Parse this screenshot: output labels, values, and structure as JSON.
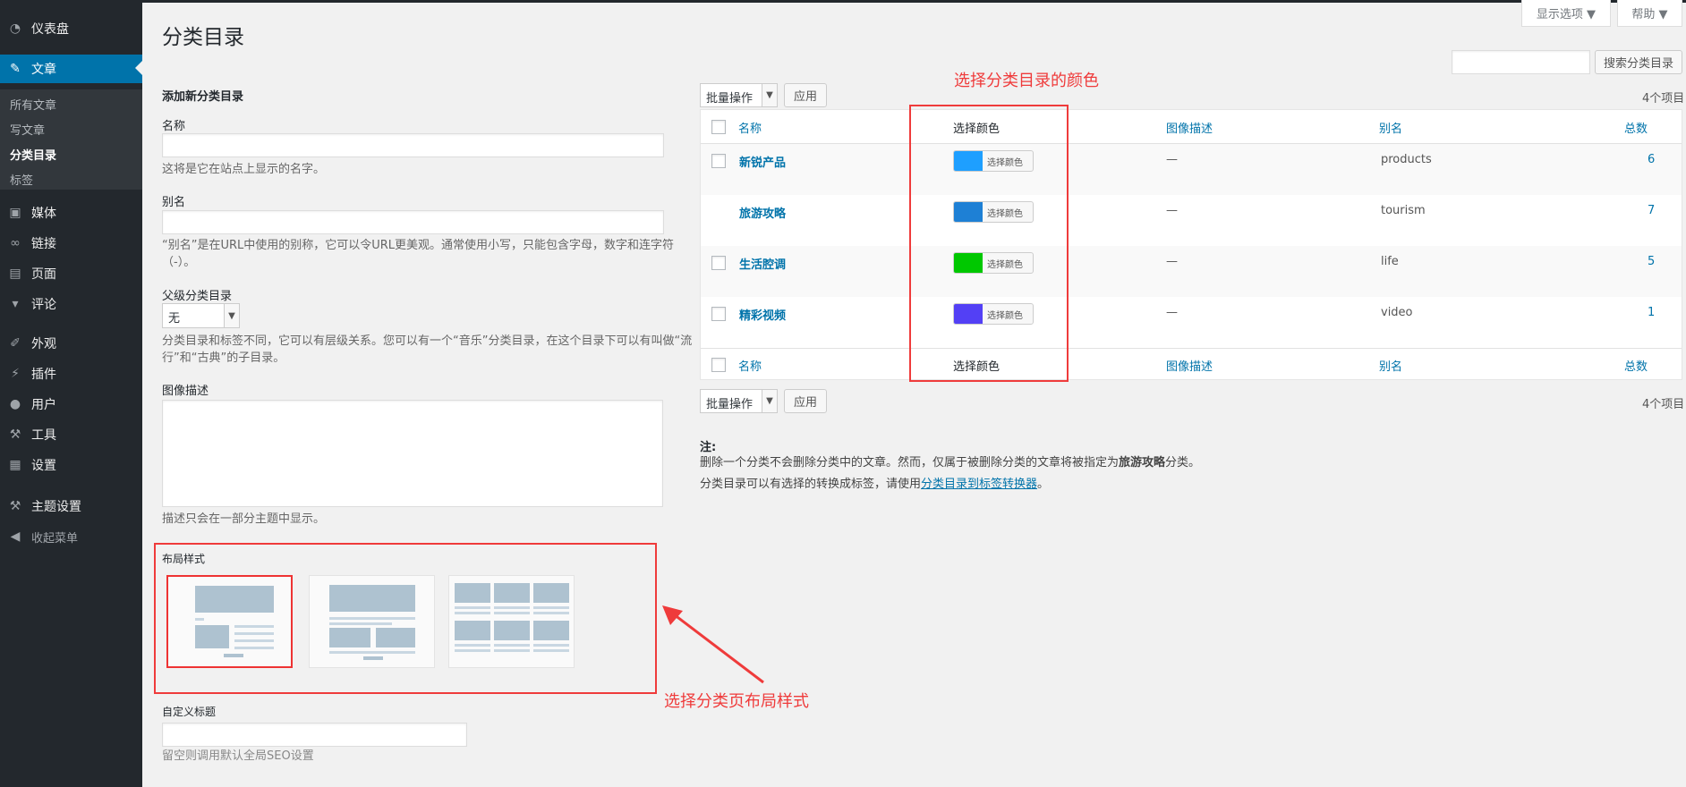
{
  "sidebar": {
    "items": [
      {
        "label": "仪表盘",
        "icon": "dashboard-icon"
      },
      {
        "label": "文章",
        "icon": "pin-icon"
      },
      {
        "label": "媒体",
        "icon": "media-icon"
      },
      {
        "label": "链接",
        "icon": "link-icon"
      },
      {
        "label": "页面",
        "icon": "page-icon"
      },
      {
        "label": "评论",
        "icon": "comment-icon"
      },
      {
        "label": "外观",
        "icon": "brush-icon"
      },
      {
        "label": "插件",
        "icon": "plugin-icon"
      },
      {
        "label": "用户",
        "icon": "user-icon"
      },
      {
        "label": "工具",
        "icon": "wrench-icon"
      },
      {
        "label": "设置",
        "icon": "settings-icon"
      },
      {
        "label": "主题设置",
        "icon": "hammer-icon"
      },
      {
        "label": "收起菜单",
        "icon": "collapse-icon"
      }
    ],
    "sub": [
      "所有文章",
      "写文章",
      "分类目录",
      "标签"
    ]
  },
  "topbar": {
    "screen_options": "显示选项 ▼",
    "help": "帮助 ▼"
  },
  "page_title": "分类目录",
  "form": {
    "heading": "添加新分类目录",
    "name_label": "名称",
    "name_help": "这将是它在站点上显示的名字。",
    "slug_label": "别名",
    "slug_help_1": "“别名”是在URL中使用的别称，它可以令URL更美观。通常使用小写，只能包含字母，数字和连字符",
    "slug_help_2": "（-）。",
    "parent_label": "父级分类目录",
    "parent_value": "无",
    "parent_help_1": "分类目录和标签不同，它可以有层级关系。您可以有一个“音乐”分类目录，在这个目录下可以有叫做“流",
    "parent_help_2": "行”和“古典”的子目录。",
    "desc_label": "图像描述",
    "desc_help": "描述只会在一部分主题中显示。",
    "layout_label": "布局样式",
    "custom_title_label": "自定义标题",
    "custom_title_help": "留空则调用默认全局SEO设置"
  },
  "search": {
    "button": "搜索分类目录"
  },
  "bulk": {
    "select": "批量操作",
    "apply": "应用",
    "count": "4个项目"
  },
  "table": {
    "headers": {
      "name": "名称",
      "color": "选择颜色",
      "desc": "图像描述",
      "slug": "别名",
      "count": "总数"
    },
    "rows": [
      {
        "name": "新锐产品",
        "color": "#1e9fff",
        "color_btn": "选择颜色",
        "desc": "—",
        "slug": "products",
        "count": "6"
      },
      {
        "name": "旅游攻略",
        "color": "#1e80d5",
        "color_btn": "选择颜色",
        "desc": "—",
        "slug": "tourism",
        "count": "7"
      },
      {
        "name": "生活腔调",
        "color": "#00c800",
        "color_btn": "选择颜色",
        "desc": "—",
        "slug": "life",
        "count": "5"
      },
      {
        "name": "精彩视频",
        "color": "#5340f5",
        "color_btn": "选择颜色",
        "desc": "—",
        "slug": "video",
        "count": "1"
      }
    ]
  },
  "notes": {
    "title": "注:",
    "line1_a": "删除一个分类不会删除分类中的文章。然而，仅属于被删除分类的文章将被指定为",
    "line1_b": "旅游攻略",
    "line1_c": "分类。",
    "line2_a": "分类目录可以有选择的转换成标签，请使用",
    "line2_link": "分类目录到标签转换器",
    "line2_c": "。"
  },
  "annotations": {
    "color_note": "选择分类目录的颜色",
    "layout_note": "选择分类页布局样式",
    "accent": "#ef3b3b"
  }
}
